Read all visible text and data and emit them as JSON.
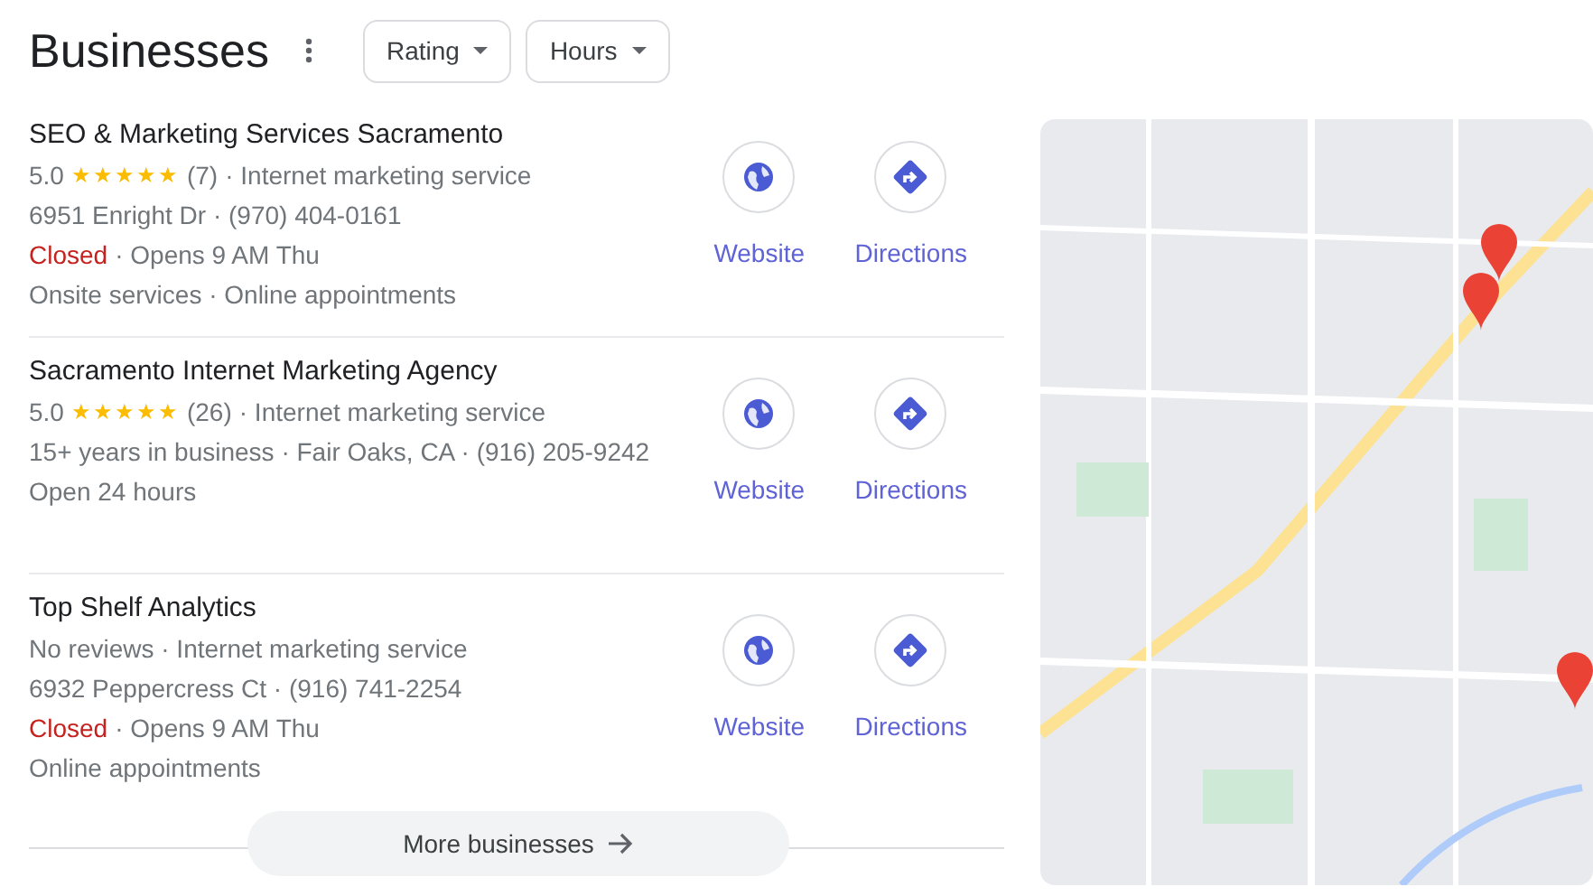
{
  "title": "Businesses",
  "filters": [
    {
      "label": "Rating"
    },
    {
      "label": "Hours"
    }
  ],
  "listings": [
    {
      "name": "SEO & Marketing Services Sacramento",
      "lines": [
        {
          "kind": "rating",
          "rating": "5.0",
          "stars": 5,
          "reviews": "(7)",
          "text": "· Internet marketing service"
        },
        {
          "kind": "plain",
          "text": "6951 Enright Dr · (970) 404-0161"
        },
        {
          "kind": "status",
          "closed": true,
          "label": "Closed",
          "text": "· Opens 9 AM Thu"
        },
        {
          "kind": "plain",
          "text": "Onsite services · Online appointments"
        }
      ],
      "actions": [
        {
          "kind": "website",
          "label": "Website"
        },
        {
          "kind": "directions",
          "label": "Directions"
        }
      ]
    },
    {
      "name": "Sacramento Internet Marketing Agency",
      "lines": [
        {
          "kind": "rating",
          "rating": "5.0",
          "stars": 5,
          "reviews": "(26)",
          "text": "· Internet marketing service"
        },
        {
          "kind": "plain",
          "text": "15+ years in business · Fair Oaks, CA · (916) 205-9242"
        },
        {
          "kind": "plain",
          "text": "Open 24 hours"
        }
      ],
      "actions": [
        {
          "kind": "website",
          "label": "Website"
        },
        {
          "kind": "directions",
          "label": "Directions"
        }
      ]
    },
    {
      "name": "Top Shelf Analytics",
      "lines": [
        {
          "kind": "plain",
          "text": "No reviews · Internet marketing service"
        },
        {
          "kind": "plain",
          "text": "6932 Peppercress Ct · (916) 741-2254"
        },
        {
          "kind": "status",
          "closed": true,
          "label": "Closed",
          "text": "· Opens 9 AM Thu"
        },
        {
          "kind": "plain",
          "text": "Online appointments"
        }
      ],
      "actions": [
        {
          "kind": "website",
          "label": "Website"
        },
        {
          "kind": "directions",
          "label": "Directions"
        }
      ]
    }
  ],
  "more_button": {
    "label": "More businesses"
  }
}
